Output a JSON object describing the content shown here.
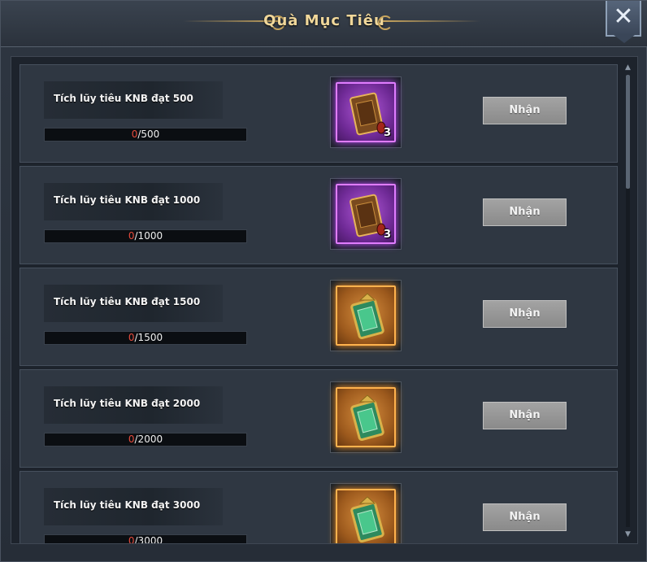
{
  "window": {
    "title": "Quà Mục Tiêu"
  },
  "icons": {
    "close": "close-icon",
    "scroll_up": "chevron-up-icon",
    "scroll_down": "chevron-down-icon"
  },
  "colors": {
    "title": "#f0d79a",
    "progress_current": "#e64a3b",
    "rare_frame": "#e07cff",
    "epic_frame": "#ffb24d"
  },
  "rewards": [
    {
      "condition": "Tích lũy tiêu KNB đạt 500",
      "current": "0",
      "target": "/500",
      "item_rarity": "purple",
      "item_icon": "card-scroll-icon",
      "item_count": "3",
      "button": "Nhận"
    },
    {
      "condition": "Tích lũy tiêu KNB đạt 1000",
      "current": "0",
      "target": "/1000",
      "item_rarity": "purple",
      "item_icon": "card-scroll-icon",
      "item_count": "3",
      "button": "Nhận"
    },
    {
      "condition": "Tích lũy tiêu KNB đạt 1500",
      "current": "0",
      "target": "/1500",
      "item_rarity": "orange",
      "item_icon": "jade-badge-icon",
      "item_count": "",
      "button": "Nhận"
    },
    {
      "condition": "Tích lũy tiêu KNB đạt 2000",
      "current": "0",
      "target": "/2000",
      "item_rarity": "orange",
      "item_icon": "jade-badge-icon",
      "item_count": "",
      "button": "Nhận"
    },
    {
      "condition": "Tích lũy tiêu KNB đạt 3000",
      "current": "0",
      "target": "/3000",
      "item_rarity": "orange",
      "item_icon": "jade-badge-icon",
      "item_count": "",
      "button": "Nhận"
    }
  ]
}
